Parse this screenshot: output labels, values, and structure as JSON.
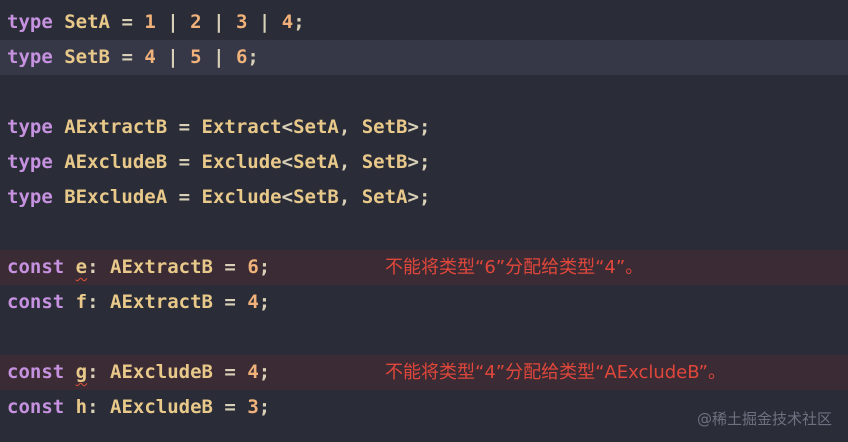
{
  "code_lines": [
    {
      "kw": "type",
      "name": "SetA",
      "rhs": [
        {
          "num": "1"
        },
        {
          "num": "2"
        },
        {
          "num": "3"
        },
        {
          "num": "4"
        }
      ]
    },
    {
      "kw": "type",
      "name": "SetB",
      "rhs": [
        {
          "num": "4"
        },
        {
          "num": "5"
        },
        {
          "num": "6"
        }
      ]
    },
    {
      "kw": "type",
      "name": "AExtractB",
      "generic": "Extract",
      "args": [
        "SetA",
        "SetB"
      ]
    },
    {
      "kw": "type",
      "name": "AExcludeB",
      "generic": "Exclude",
      "args": [
        "SetA",
        "SetB"
      ]
    },
    {
      "kw": "type",
      "name": "BExcludeA",
      "generic": "Exclude",
      "args": [
        "SetB",
        "SetA"
      ]
    },
    {
      "kw": "const",
      "var": "e",
      "type": "AExtractB",
      "value": "6"
    },
    {
      "kw": "const",
      "var": "f",
      "type": "AExtractB",
      "value": "4"
    },
    {
      "kw": "const",
      "var": "g",
      "type": "AExcludeB",
      "value": "4"
    },
    {
      "kw": "const",
      "var": "h",
      "type": "AExcludeB",
      "value": "3"
    }
  ],
  "syntax": {
    "equals": "=",
    "pipe": "|",
    "semicolon": ";",
    "colon": ":",
    "comma": ",",
    "lt": "<",
    "gt": ">"
  },
  "diagnostics": {
    "e": "不能将类型“6”分配给类型“4”。",
    "g": "不能将类型“4”分配给类型“AExcludeB”。"
  },
  "watermark": "@稀土掘金技术社区",
  "colors": {
    "background": "#2a2c38",
    "active_line": "#363848",
    "error_line": "#3a2b34",
    "keyword": "#c692e0",
    "type_name": "#e8c98a",
    "number": "#f0b27a",
    "error_text": "#e0473b"
  }
}
